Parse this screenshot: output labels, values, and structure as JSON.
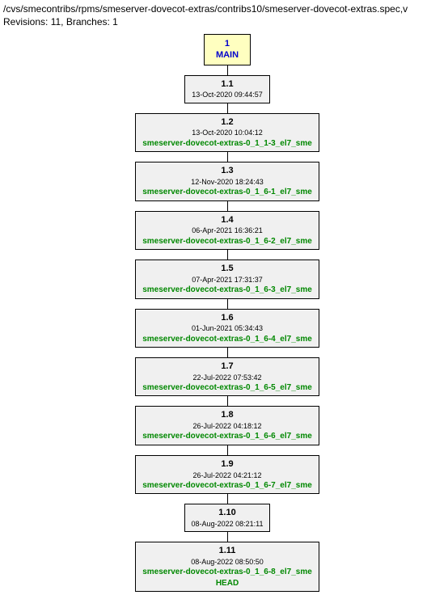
{
  "header": {
    "path": "/cvs/smecontribs/rpms/smeserver-dovecot-extras/contribs10/smeserver-dovecot-extras.spec,v",
    "info": "Revisions: 11, Branches: 1"
  },
  "branch": {
    "num": "1",
    "name": "MAIN"
  },
  "revisions": [
    {
      "num": "1.1",
      "date": "13-Oct-2020 09:44:57",
      "tag": "",
      "head": ""
    },
    {
      "num": "1.2",
      "date": "13-Oct-2020 10:04:12",
      "tag": "smeserver-dovecot-extras-0_1_1-3_el7_sme",
      "head": ""
    },
    {
      "num": "1.3",
      "date": "12-Nov-2020 18:24:43",
      "tag": "smeserver-dovecot-extras-0_1_6-1_el7_sme",
      "head": ""
    },
    {
      "num": "1.4",
      "date": "06-Apr-2021 16:36:21",
      "tag": "smeserver-dovecot-extras-0_1_6-2_el7_sme",
      "head": ""
    },
    {
      "num": "1.5",
      "date": "07-Apr-2021 17:31:37",
      "tag": "smeserver-dovecot-extras-0_1_6-3_el7_sme",
      "head": ""
    },
    {
      "num": "1.6",
      "date": "01-Jun-2021 05:34:43",
      "tag": "smeserver-dovecot-extras-0_1_6-4_el7_sme",
      "head": ""
    },
    {
      "num": "1.7",
      "date": "22-Jul-2022 07:53:42",
      "tag": "smeserver-dovecot-extras-0_1_6-5_el7_sme",
      "head": ""
    },
    {
      "num": "1.8",
      "date": "26-Jul-2022 04:18:12",
      "tag": "smeserver-dovecot-extras-0_1_6-6_el7_sme",
      "head": ""
    },
    {
      "num": "1.9",
      "date": "26-Jul-2022 04:21:12",
      "tag": "smeserver-dovecot-extras-0_1_6-7_el7_sme",
      "head": ""
    },
    {
      "num": "1.10",
      "date": "08-Aug-2022 08:21:11",
      "tag": "",
      "head": ""
    },
    {
      "num": "1.11",
      "date": "08-Aug-2022 08:50:50",
      "tag": "smeserver-dovecot-extras-0_1_6-8_el7_sme",
      "head": "HEAD"
    }
  ]
}
